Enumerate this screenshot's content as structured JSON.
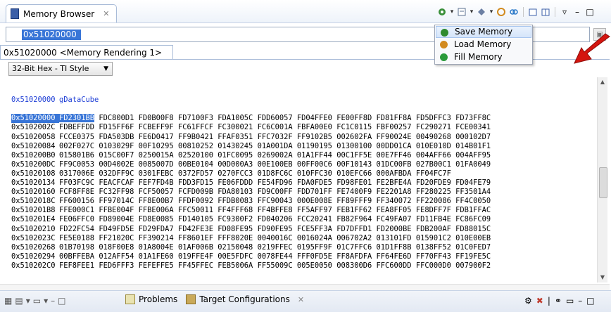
{
  "view": {
    "title": "Memory Browser",
    "close_glyph": "✕"
  },
  "address_bar": {
    "value": "0x51020000"
  },
  "rendering_tab": {
    "label": "0x51020000 <Memory Rendering 1>",
    "close_glyph": "✕"
  },
  "format_select": {
    "selected": "32-Bit Hex - TI Style"
  },
  "toolbar_menu": {
    "items": [
      {
        "label": "Save Memory",
        "icon": "save-memory-icon",
        "color": "#2f8a2f"
      },
      {
        "label": "Load Memory",
        "icon": "load-memory-icon",
        "color": "#d28a1e"
      },
      {
        "label": "Fill Memory",
        "icon": "fill-memory-icon",
        "color": "#2a9a3a"
      }
    ]
  },
  "memory": {
    "symbol_label": {
      "address": "0x51020000",
      "text": "gDataCube"
    },
    "rows": [
      {
        "address": "0x51020000",
        "words": [
          "FD2301BB",
          "FDC800D1",
          "FD0B00F8",
          "FD7100F3",
          "FDA1005C",
          "FDD60057",
          "FD04FFE0",
          "FE00FF8D",
          "FD81FF8A",
          "FD5DFFC3",
          "FD73FF8C"
        ]
      },
      {
        "address": "0x5102002C",
        "words": [
          "FDBEFFDD",
          "FD15FF6F",
          "FCBEFF9F",
          "FC61FFCF",
          "FC300021",
          "FC6C001A",
          "FBFA00E0",
          "FC1C0115",
          "FBF00257",
          "FC290271",
          "FCE00341"
        ]
      },
      {
        "address": "0x51020058",
        "words": [
          "FCCE0375",
          "FDA503DB",
          "FE6D0417",
          "FF9B0421",
          "FFAF0351",
          "FFC7032F",
          "FF9102B5",
          "002602FA",
          "FF90024E",
          "00490268",
          "000102D7"
        ]
      },
      {
        "address": "0x51020084",
        "words": [
          "002F027C",
          "0103029F",
          "00F10295",
          "00810252",
          "01430245",
          "01A001DA",
          "01190195",
          "01300100",
          "00DD01CA",
          "010E010D",
          "014B01F1"
        ]
      },
      {
        "address": "0x510200B0",
        "words": [
          "015801B6",
          "015C00F7",
          "0250015A",
          "02520100",
          "01FC0095",
          "0269002A",
          "01A1FF44",
          "00C1FF5E",
          "00E7FF46",
          "004AFF66",
          "004AFF95"
        ]
      },
      {
        "address": "0x510200DC",
        "words": [
          "FF9C0053",
          "00D4002E",
          "0085007D",
          "00BE0104",
          "00D000A3",
          "00E100EB",
          "00FF00C6",
          "00F10143",
          "01DC00FB",
          "027B00C1",
          "01FA0049"
        ]
      },
      {
        "address": "0x51020108",
        "words": [
          "0317006E",
          "032DFF9C",
          "0301FEBC",
          "0372FD57",
          "0270FCC3",
          "01D8FC6C",
          "010FFC30",
          "010EFC66",
          "000AFBDA",
          "FF04FC7F",
          ""
        ]
      },
      {
        "address": "0x51020134",
        "words": [
          "FF03FC9C",
          "FEACFCAF",
          "FEF7FD4B",
          "FDD3FD15",
          "FE06FDDD",
          "FE54FD96",
          "FDA0FDE5",
          "FD98FE01",
          "FE2BFE4A",
          "FD20FDE9",
          "FD04FE79"
        ]
      },
      {
        "address": "0x51020160",
        "words": [
          "FCF8FF8E",
          "FC32FF98",
          "FCF50057",
          "FCFD009B",
          "FDA80103",
          "FD9C00FF",
          "FDD701FF",
          "FE7400F9",
          "FE2201A8",
          "FF280225",
          "FF3501A4"
        ]
      },
      {
        "address": "0x5102018C",
        "words": [
          "FF600156",
          "FF97014C",
          "FF8E00B7",
          "FFDF0092",
          "FFDB0083",
          "FFC90043",
          "000E008E",
          "FF89FFF9",
          "FF340072",
          "FF220086",
          "FF4C0050"
        ]
      },
      {
        "address": "0x510201B8",
        "words": [
          "FFE000C1",
          "FFBE004F",
          "FFBE006A",
          "FFC50011",
          "FF4FFF68",
          "FF4BFFE8",
          "FF5AFF97",
          "FEB1FF62",
          "FEA8FF05",
          "FE8DFF7F",
          "FDB1FFAC"
        ]
      },
      {
        "address": "0x510201E4",
        "words": [
          "FE06FFC0",
          "FD89004E",
          "FD8E0085",
          "FD140105",
          "FC9300F2",
          "FD040206",
          "FCC20241",
          "FB82F964",
          "FC49FA07",
          "FD11FB4E",
          "FC86FC09"
        ]
      },
      {
        "address": "0x51020210",
        "words": [
          "FD22FC54",
          "FD49FD5E",
          "FD29FDA7",
          "FD42FE3E",
          "FD08FE95",
          "FD90FE95",
          "FCE5FF3A",
          "FD7DFFD1",
          "FD2000BE",
          "FDB200AF",
          "FD88015C"
        ]
      },
      {
        "address": "0x5102023C",
        "words": [
          "FE5E0188",
          "FF21020C",
          "FF390214",
          "FF8601EF",
          "FFF8020E",
          "0040016C",
          "0016024A",
          "006702A2",
          "013101FD",
          "015901C2",
          "010E00EB"
        ]
      },
      {
        "address": "0x51020268",
        "words": [
          "01B70198",
          "018F00E8",
          "01A8004E",
          "01AF006B",
          "02150048",
          "0219FFEC",
          "0195FF9F",
          "01C7FFC6",
          "01D1FF8B",
          "0138FF52",
          "01C0FED7"
        ]
      },
      {
        "address": "0x51020294",
        "words": [
          "00BFFEBA",
          "012AFF54",
          "01A1FE60",
          "019FFE4F",
          "00E5FDFC",
          "0078FE44",
          "FFF0FD5E",
          "FF8AFDFA",
          "FF64FE6D",
          "FF70FF43",
          "FF19FE5C"
        ]
      },
      {
        "address": "0x510202C0",
        "words": [
          "FEF8FEE1",
          "FED6FFF3",
          "FEFEFFE5",
          "FF45FFEC",
          "FEB5006A",
          "FF55009C",
          "005E0050",
          "008300D6",
          "FFC600DD",
          "FFC000D0",
          "007900F2"
        ]
      }
    ]
  },
  "bottom": {
    "tabs": [
      {
        "label": "Problems"
      },
      {
        "label": "Target Configurations",
        "close_glyph": "✕"
      }
    ]
  }
}
